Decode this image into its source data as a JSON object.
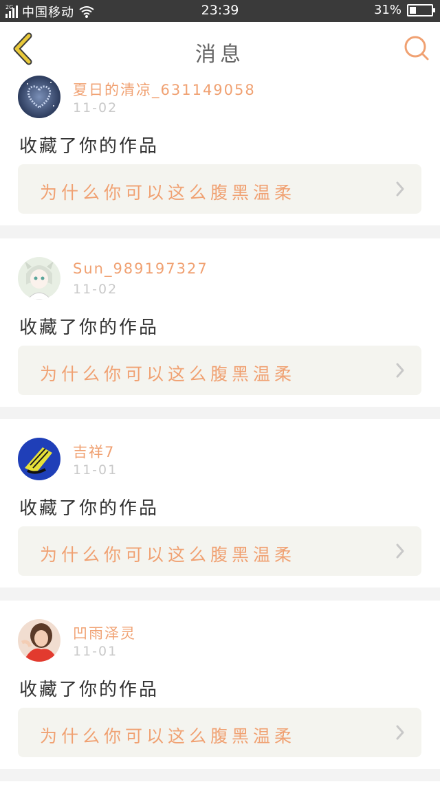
{
  "status_bar": {
    "network_tag": "2G",
    "carrier": "中国移动",
    "time": "23:39",
    "battery_text": "31%",
    "battery_level": 0.31
  },
  "nav": {
    "title": "消息"
  },
  "colors": {
    "accent": "#f0a172",
    "back_arrow": "#e9c93a",
    "item_bg": "#f4f4ef"
  },
  "messages": [
    {
      "username": "夏日的清凉_631149058",
      "date": "11-02",
      "action": "收藏了你的作品",
      "work_title": "为什么你可以这么腹黑温柔"
    },
    {
      "username": "Sun_989197327",
      "date": "11-02",
      "action": "收藏了你的作品",
      "work_title": "为什么你可以这么腹黑温柔"
    },
    {
      "username": "吉祥7",
      "date": "11-01",
      "action": "收藏了你的作品",
      "work_title": "为什么你可以这么腹黑温柔"
    },
    {
      "username": "凹雨泽灵",
      "date": "11-01",
      "action": "收藏了你的作品",
      "work_title": "为什么你可以这么腹黑温柔"
    }
  ]
}
